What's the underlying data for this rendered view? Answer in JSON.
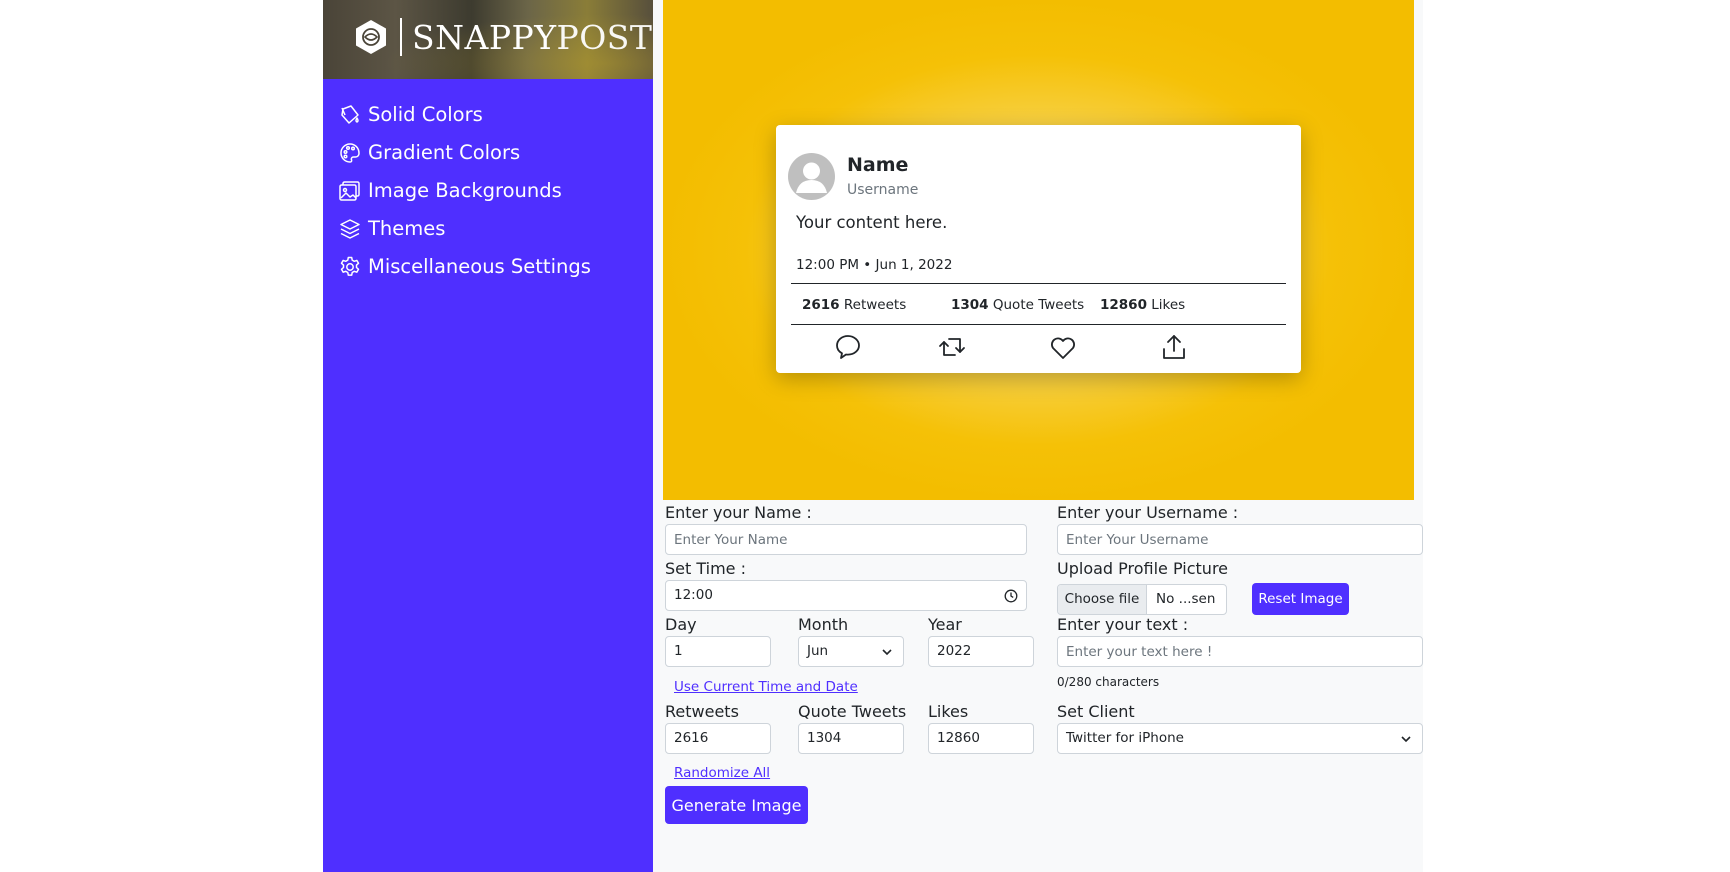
{
  "brand": {
    "name_part1": "SNAPPY",
    "name_part2": "POST"
  },
  "sidebar": {
    "items": [
      {
        "label": "Solid Colors",
        "icon": "paint-bucket-icon"
      },
      {
        "label": "Gradient Colors",
        "icon": "palette-icon"
      },
      {
        "label": "Image Backgrounds",
        "icon": "images-icon"
      },
      {
        "label": "Themes",
        "icon": "layers-icon"
      },
      {
        "label": "Miscellaneous Settings",
        "icon": "gear-icon"
      }
    ],
    "color": "#4f2fff"
  },
  "preview": {
    "background_colors": [
      "#fbe27a",
      "#f5c107"
    ],
    "card": {
      "name": "Name",
      "username": "Username",
      "content": "Your content here.",
      "timestamp": "12:00 PM • Jun 1, 2022",
      "stats": {
        "retweets_count": "2616",
        "retweets_label": "Retweets",
        "quotes_count": "1304",
        "quotes_label": "Quote Tweets",
        "likes_count": "12860",
        "likes_label": "Likes"
      },
      "actions": [
        "reply-icon",
        "retweet-icon",
        "like-icon",
        "share-icon"
      ]
    }
  },
  "form": {
    "name": {
      "label": "Enter your Name :",
      "placeholder": "Enter Your Name",
      "value": ""
    },
    "username": {
      "label": "Enter your Username :",
      "placeholder": "Enter Your Username",
      "value": ""
    },
    "time": {
      "label": "Set Time :",
      "value": "12:00"
    },
    "profile": {
      "label": "Upload Profile Picture",
      "choose_label": "Choose file",
      "file_status": "No ...sen",
      "reset_label": "Reset Image"
    },
    "day": {
      "label": "Day",
      "value": "1"
    },
    "month": {
      "label": "Month",
      "value": "Jun"
    },
    "year": {
      "label": "Year",
      "value": "2022"
    },
    "text": {
      "label": "Enter your text :",
      "placeholder": "Enter your text here !",
      "char_count": "0/280 characters"
    },
    "current_time_link": "Use Current Time and Date",
    "retweets": {
      "label": "Retweets",
      "value": "2616"
    },
    "quotes": {
      "label": "Quote Tweets",
      "value": "1304"
    },
    "likes": {
      "label": "Likes",
      "value": "12860"
    },
    "client": {
      "label": "Set Client",
      "value": "Twitter for iPhone"
    },
    "randomize_link": "Randomize All",
    "generate_label": "Generate Image"
  }
}
